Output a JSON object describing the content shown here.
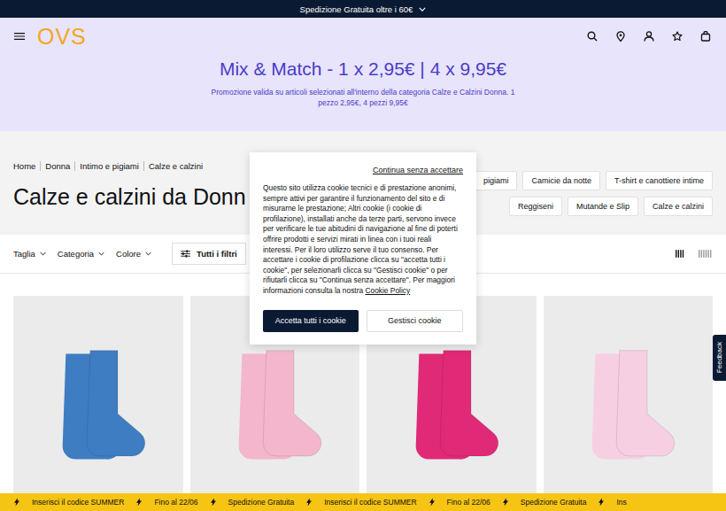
{
  "top_bar": {
    "text": "Spedizione Gratuita oltre i 60€"
  },
  "header": {
    "logo": "OVS"
  },
  "promo": {
    "title": "Mix & Match - 1 x 2,95€ | 4 x 9,95€",
    "subtitle": "Promozione valida su articoli selezionati all'interno della categoria Calze e Calzini Donna. 1 pezzo 2,95€, 4 pezzi 9,95€"
  },
  "breadcrumb": [
    "Home",
    "Donna",
    "Intimo e pigiami",
    "Calze e calzini"
  ],
  "page_title": "Calze e calzini da Donn",
  "category_chips": [
    "pigiami",
    "Camicie da notte",
    "T-shirt e canottiere intime",
    "Reggiseni",
    "Mutande e Slip",
    "Calze e calzini"
  ],
  "filters": [
    "Taglia",
    "Categoria",
    "Colore"
  ],
  "all_filters_button": "Tutti i filtri",
  "view_toggle": [
    {
      "columns": 4,
      "selected": true
    },
    {
      "columns": 6,
      "selected": false
    }
  ],
  "products": [
    {
      "color": "#3f7dc2"
    },
    {
      "color": "#f4b6cc"
    },
    {
      "color": "#e02a78"
    },
    {
      "color": "#f6cfe3"
    }
  ],
  "ticker": [
    "Inserisci il codice SUMMER",
    "Fino al 22/06",
    "Spedizione Gratuita",
    "Inserisci il codice SUMMER",
    "Fino al 22/06",
    "Spedizione Gratuita",
    "Ins"
  ],
  "feedback_tab": "Feedback",
  "cookie_banner": {
    "skip": "Continua senza accettare",
    "body": "Questo sito utilizza cookie tecnici e di prestazione anonimi, sempre attivi per garantire il funzionamento del sito e di misurarne le prestazione; Altri cookie (i cookie di profilazione), installati anche da terze parti, servono invece per verificare le tue abitudini di navigazione al fine di poterti offrire prodotti e servizi mirati in linea con i tuoi reali interessi. Per il loro utilizzo serve il tuo consenso. Per accettare i cookie di profilazione clicca su \"accetta tutti i cookie\", per selezionarli clicca su \"Gestisci cookie\" o per rifiutarli clicca su \"Continua senza accettare\". Per maggiori informazioni consulta la nostra",
    "link": "Cookie Policy",
    "accept": "Accetta tutti i cookie",
    "manage": "Gestisci cookie"
  }
}
